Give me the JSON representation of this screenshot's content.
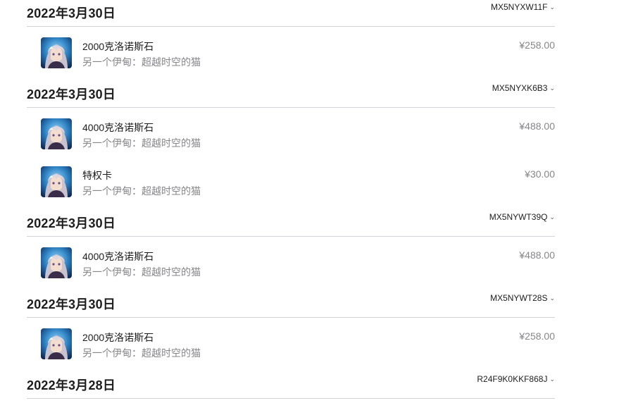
{
  "orders": [
    {
      "date": "2022年3月30日",
      "order_id": "MX5NYXW11F",
      "items": [
        {
          "name": "2000克洛诺斯石",
          "subtitle": "另一个伊甸：超越时空的猫",
          "price": "¥258.00",
          "icon": "app-icon"
        }
      ]
    },
    {
      "date": "2022年3月30日",
      "order_id": "MX5NYXK6B3",
      "items": [
        {
          "name": "4000克洛诺斯石",
          "subtitle": "另一个伊甸：超越时空的猫",
          "price": "¥488.00",
          "icon": "app-icon"
        },
        {
          "name": "特权卡",
          "subtitle": "另一个伊甸：超越时空的猫",
          "price": "¥30.00",
          "icon": "app-icon"
        }
      ]
    },
    {
      "date": "2022年3月30日",
      "order_id": "MX5NYWT39Q",
      "items": [
        {
          "name": "4000克洛诺斯石",
          "subtitle": "另一个伊甸：超越时空的猫",
          "price": "¥488.00",
          "icon": "app-icon"
        }
      ]
    },
    {
      "date": "2022年3月30日",
      "order_id": "MX5NYWT28S",
      "items": [
        {
          "name": "2000克洛诺斯石",
          "subtitle": "另一个伊甸：超越时空的猫",
          "price": "¥258.00",
          "icon": "app-icon"
        }
      ]
    },
    {
      "date": "2022年3月28日",
      "order_id": "R24F9K0KKF868J",
      "items": []
    }
  ],
  "colors": {
    "text_primary": "#1d1d1f",
    "text_secondary": "#86868b",
    "divider": "#d2d2d7"
  },
  "icons": {
    "order_expand": "chevron-down-icon",
    "app": "app-icon"
  }
}
